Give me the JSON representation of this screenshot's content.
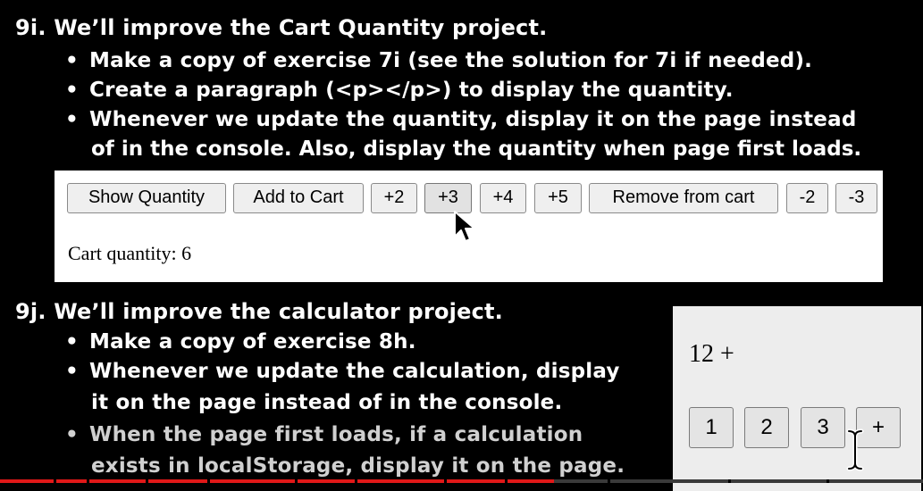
{
  "section_9i": {
    "heading": "9i. We’ll improve the Cart Quantity project.",
    "bullets": [
      "Make a copy of exercise 7i (see the solution for 7i if needed).",
      "Create a paragraph (<p></p>) to display the quantity.",
      "Whenever we update the quantity, display it on the page instead"
    ],
    "bullet3_cont": "of in the console. Also, display the quantity when page first loads."
  },
  "cart_demo": {
    "buttons": [
      "Show Quantity",
      "Add to Cart",
      "+2",
      "+3",
      "+4",
      "+5",
      "Remove from cart",
      "-2",
      "-3"
    ],
    "quantity_text": "Cart quantity: 6"
  },
  "section_9j": {
    "heading": "9j. We’ll improve the calculator project.",
    "bullet1": "Make a copy of exercise 8h.",
    "bullet2": "Whenever we update the calculation, display",
    "bullet2_cont": "it on the page instead of in the console.",
    "bullet3": "When the page first loads, if a calculation",
    "bullet3_cont": "exists in localStorage, display it on the page."
  },
  "calc_demo": {
    "display": "12 +",
    "buttons": [
      "1",
      "2",
      "3",
      "+"
    ]
  },
  "bullet_glyph": "•",
  "video": {
    "progress": 0.6
  },
  "colors": {
    "background": "#000000",
    "text": "#ffffff",
    "progress": "#e01818"
  }
}
